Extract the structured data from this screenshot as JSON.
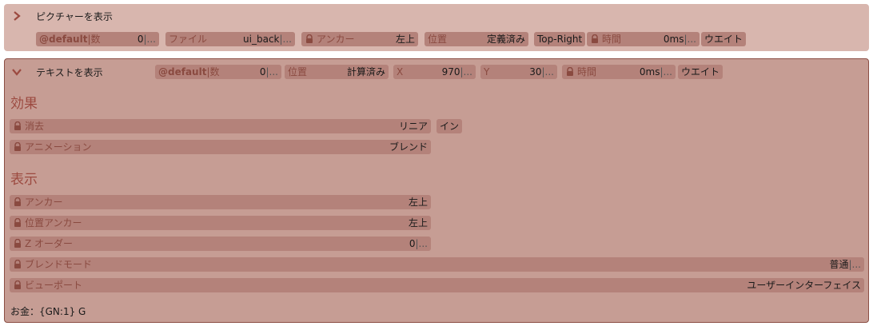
{
  "panel1": {
    "title": "ピクチャーを表示",
    "fields": [
      {
        "label": "@default",
        "sep": "|",
        "label2": "数",
        "value": "0",
        "dots": "|..."
      },
      {
        "label": "ファイル",
        "value": "ui_back",
        "dots": "|..."
      },
      {
        "label": "アンカー",
        "value": "左上"
      },
      {
        "label": "位置",
        "value": "定義済み"
      },
      {
        "button": "Top-Right"
      },
      {
        "label": "時間",
        "value": "0ms",
        "dots": "|..."
      },
      {
        "button": "ウエイト"
      }
    ]
  },
  "panel2": {
    "title": "テキストを表示",
    "fields": [
      {
        "label": "@default",
        "label2": "数",
        "value": "0",
        "dots": "|..."
      },
      {
        "label": "位置",
        "value": "計算済み"
      },
      {
        "label": "X",
        "value": "970",
        "dots": "|..."
      },
      {
        "label": "Y",
        "value": "30",
        "dots": "|..."
      },
      {
        "label": "時間",
        "value": "0ms",
        "dots": "|..."
      },
      {
        "button": "ウエイト"
      }
    ],
    "effects": {
      "heading": "効果",
      "fade": {
        "label": "消去",
        "value": "リニア",
        "button": "イン"
      },
      "animation": {
        "label": "アニメーション",
        "value": "ブレンド"
      }
    },
    "display": {
      "heading": "表示",
      "anchor": {
        "label": "アンカー",
        "value": "左上"
      },
      "pos_anchor": {
        "label": "位置アンカー",
        "value": "左上"
      },
      "z_order": {
        "label": "Z オーダー",
        "value": "0",
        "dots": "|..."
      },
      "blend_mode": {
        "label": "ブレンドモード",
        "value": "普通",
        "dots": "|..."
      },
      "viewport": {
        "label": "ビューポート",
        "value": "ユーザーインターフェイス"
      }
    },
    "footer": "お金：{GN:1} G"
  },
  "colors": {
    "accent": "#9c4a40",
    "field": "#b4827a",
    "panel1": "#d8b6ae",
    "panel2": "#c69d94"
  }
}
